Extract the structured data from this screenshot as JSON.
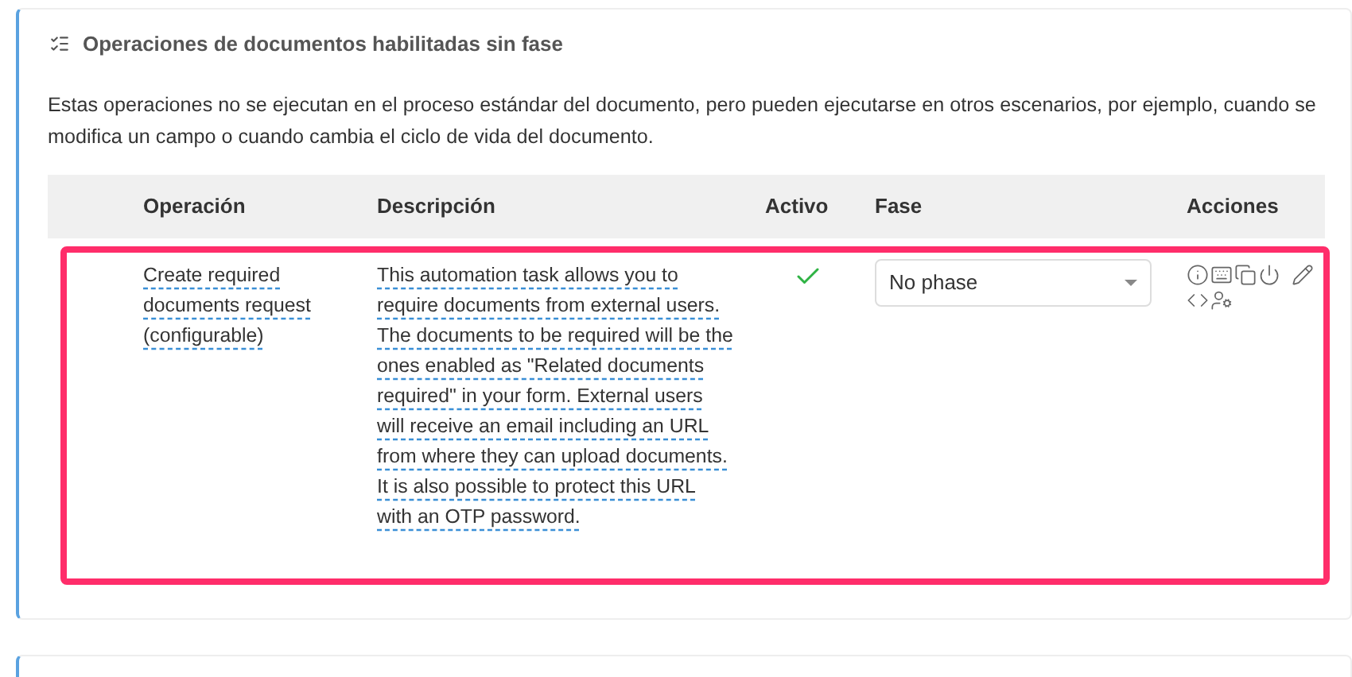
{
  "section": {
    "title": "Operaciones de documentos habilitadas sin fase",
    "description": "Estas operaciones no se ejecutan en el proceso estándar del documento, pero pueden ejecutarse en otros escenarios, por ejemplo, cuando se modifica un campo o cuando cambia el ciclo de vida del documento."
  },
  "table": {
    "columns": [
      "Operación",
      "Descripción",
      "Activo",
      "Fase",
      "Acciones"
    ],
    "rows": [
      {
        "operation": "Create required documents request (configurable)",
        "description": "This automation task allows you to require documents from external users. The documents to be required will be the ones enabled as \"Related documents required\" in your form. External users will receive an email including an URL from where they can upload documents. It is also possible to protect this URL with an OTP password.",
        "active": true,
        "phase": "No phase",
        "highlighted": true
      }
    ]
  }
}
